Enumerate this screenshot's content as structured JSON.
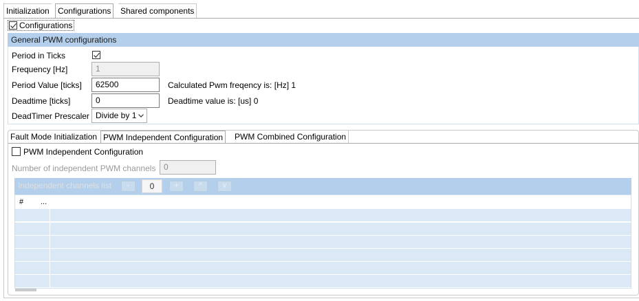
{
  "top_tabs": [
    {
      "label": "Initialization",
      "active": false
    },
    {
      "label": "Configurations",
      "active": true
    },
    {
      "label": "Shared components",
      "active": false
    }
  ],
  "configurations_checkbox": {
    "label": "Configurations",
    "checked": true
  },
  "general": {
    "header": "General PWM configurations",
    "period_in_ticks": {
      "label": "Period in Ticks",
      "checked": true
    },
    "frequency": {
      "label": "Frequency [Hz]",
      "value": "1",
      "disabled": true
    },
    "period_value": {
      "label": "Period Value [ticks]",
      "value": "62500",
      "info": "Calculated Pwm freqency is: [Hz] 1"
    },
    "deadtime": {
      "label": "Deadtime [ticks]",
      "value": "0",
      "info": "Deadtime value is: [us] 0"
    },
    "prescaler": {
      "label": "DeadTimer Prescaler",
      "value": "Divide by 1"
    }
  },
  "sub_tabs": [
    {
      "label": "Fault Mode Initialization",
      "active": false
    },
    {
      "label": "PWM Independent Configuration",
      "active": true
    },
    {
      "label": "PWM Combined Configuration",
      "active": false
    }
  ],
  "independent": {
    "checkbox_label": "PWM Independent Configuration",
    "checked": false,
    "channels_label": "Number of independent PWM channels",
    "channels_value": "0",
    "list_title": "Independent channels list",
    "btn_minus": "-",
    "spin_value": "0",
    "btn_plus": "+",
    "btn_up": "^",
    "btn_down": "v",
    "columns": [
      "#",
      "..."
    ]
  },
  "icons": {
    "checkmark": "checkmark-icon",
    "dropdown": "chevron-down-icon"
  }
}
